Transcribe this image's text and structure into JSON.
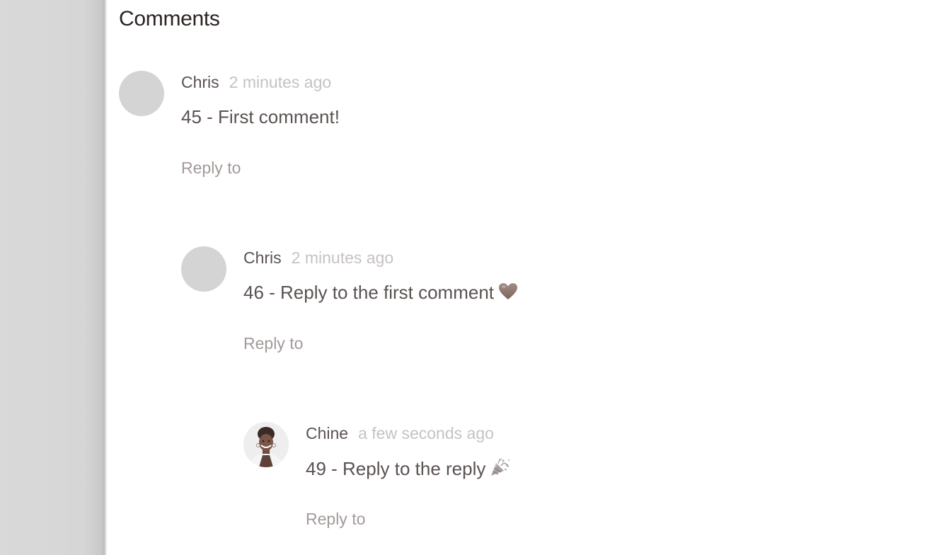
{
  "page": {
    "title": "Comments"
  },
  "comments": [
    {
      "author": "Chris",
      "time": "2 minutes ago",
      "text": "45 - First comment!",
      "reply_label": "Reply to",
      "avatar": "gray-placeholder"
    },
    {
      "author": "Chris",
      "time": "2 minutes ago",
      "text": "46 - Reply to the first comment",
      "emoji": "heart-icon",
      "reply_label": "Reply to",
      "avatar": "gray-placeholder"
    },
    {
      "author": "Chine",
      "time": "a few seconds ago",
      "text": "49 - Reply to the reply",
      "emoji": "party-popper-icon",
      "reply_label": "Reply to",
      "avatar": "user-photo"
    }
  ],
  "colors": {
    "left_rail": "#d9d9d9",
    "title": "#2b2322",
    "author": "#5b5251",
    "timestamp": "#c7c2c1",
    "reply_link": "#a39a99",
    "avatar_placeholder": "#d4d4d4"
  }
}
